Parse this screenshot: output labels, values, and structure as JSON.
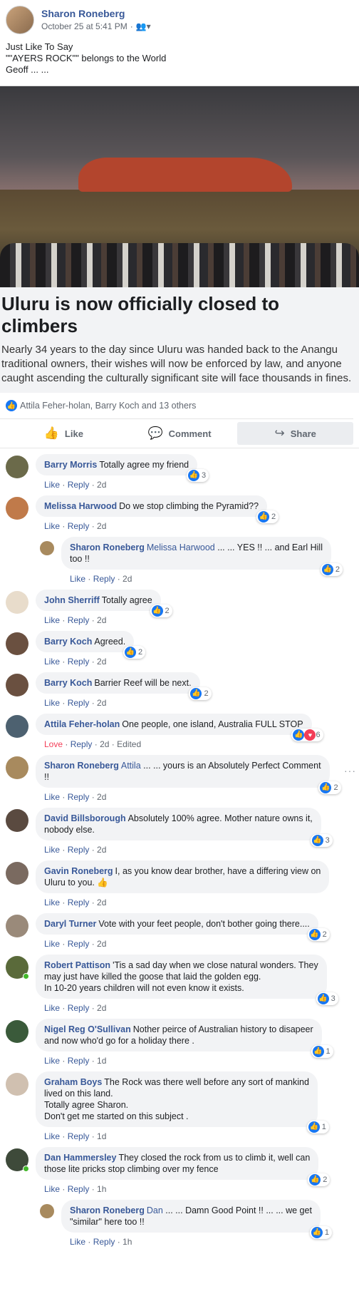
{
  "post": {
    "author": "Sharon Roneberg",
    "time": "October 25 at 5:41 PM",
    "audience_icon": "friends-icon",
    "text_lines": [
      "Just Like To Say",
      "\"\"AYERS ROCK\"\" belongs to the World",
      "Geoff ... ..."
    ]
  },
  "link": {
    "title": "Uluru is now officially closed to climbers",
    "description": "Nearly 34 years to the day since Uluru was handed back to the Anangu traditional owners, their wishes will now be enforced by law, and anyone caught ascending the culturally significant site will face thousands in fines."
  },
  "reactions_summary": "Attila Feher-holan, Barry Koch and 13 others",
  "actions": {
    "like": "Like",
    "comment": "Comment",
    "share": "Share"
  },
  "comment_actions": {
    "like": "Like",
    "reply": "Reply",
    "edited": "Edited"
  },
  "comments": [
    {
      "name": "Barry Morris",
      "text": "Totally agree my friend",
      "time": "2d",
      "count": "3",
      "avatar_color": "#6b6a4a"
    },
    {
      "name": "Melissa Harwood",
      "text": "Do we stop climbing the Pyramid??",
      "time": "2d",
      "count": "2",
      "avatar_color": "#c07a4a"
    },
    {
      "name": "Sharon Roneberg",
      "mention": "Melissa Harwood",
      "text": " ... ... YES !! ... and Earl Hill\ntoo !!",
      "time": "2d",
      "count": "2",
      "avatar_color": "#a88a5e"
    },
    {
      "name": "John Sherriff",
      "text": "Totally agree",
      "time": "2d",
      "count": "2",
      "avatar_color": "#e8dccb"
    },
    {
      "name": "Barry Koch",
      "text": "Agreed.",
      "time": "2d",
      "count": "2",
      "avatar_color": "#6a5040"
    },
    {
      "name": "Barry Koch",
      "text": "Barrier Reef will be next.",
      "time": "2d",
      "count": "2",
      "avatar_color": "#6a5040"
    },
    {
      "name": "Attila Feher-holan",
      "text": "One people, one island, Australia FULL STOP",
      "time": "2d",
      "reaction": "Love",
      "count": "6",
      "avatar_color": "#4d6170"
    },
    {
      "name": "Sharon Roneberg",
      "mention": "Attila",
      "text": " ... ... yours is an Absolutely Perfect Comment\n!!",
      "time": "2d",
      "count": "2",
      "avatar_color": "#a88a5e"
    },
    {
      "name": "David Billsborough",
      "text": "Absolutely 100% agree. Mother nature owns it,\nnobody else.",
      "time": "2d",
      "count": "3",
      "avatar_color": "#5a4a40"
    },
    {
      "name": "Gavin Roneberg",
      "text": "I, as you know dear brother, have a differing view on\nUluru to you. 👍",
      "time": "2d",
      "avatar_color": "#7a6a60"
    },
    {
      "name": "Daryl Turner",
      "text": "Vote with your feet people, don't bother going there....",
      "time": "2d",
      "count": "2",
      "avatar_color": "#9a8a7a"
    },
    {
      "name": "Robert Pattison",
      "text": "'Tis a sad day when we close natural wonders. They\nmay just have killed the goose that laid the golden egg.\nIn 10-20 years children will not even know it exists.",
      "time": "2d",
      "count": "3",
      "avatar_color": "#5a6a3a"
    },
    {
      "name": "Nigel Reg O'Sullivan",
      "text": "Nother peirce of Australian history to disapeer\nand now who'd go for a holiday there .",
      "time": "1d",
      "count": "1",
      "avatar_color": "#3a5a3a"
    },
    {
      "name": "Graham Boys",
      "text": "The Rock was there well before any sort of mankind\nlived on this land.\nTotally agree Sharon.\nDon't get me started on this subject .",
      "time": "1d",
      "count": "1",
      "avatar_color": "#d0c0b0"
    },
    {
      "name": "Dan Hammersley",
      "text": "They closed the rock from us to climb it, well can\nthose lite pricks stop climbing over my fence",
      "time": "1h",
      "count": "2",
      "avatar_color": "#3e4a3a"
    },
    {
      "name": "Sharon Roneberg",
      "mention": "Dan",
      "text": " ... ... Damn Good Point !! ... ... we get\n\"similar\" here too !!",
      "time": "1h",
      "count": "1",
      "avatar_color": "#a88a5e"
    }
  ]
}
